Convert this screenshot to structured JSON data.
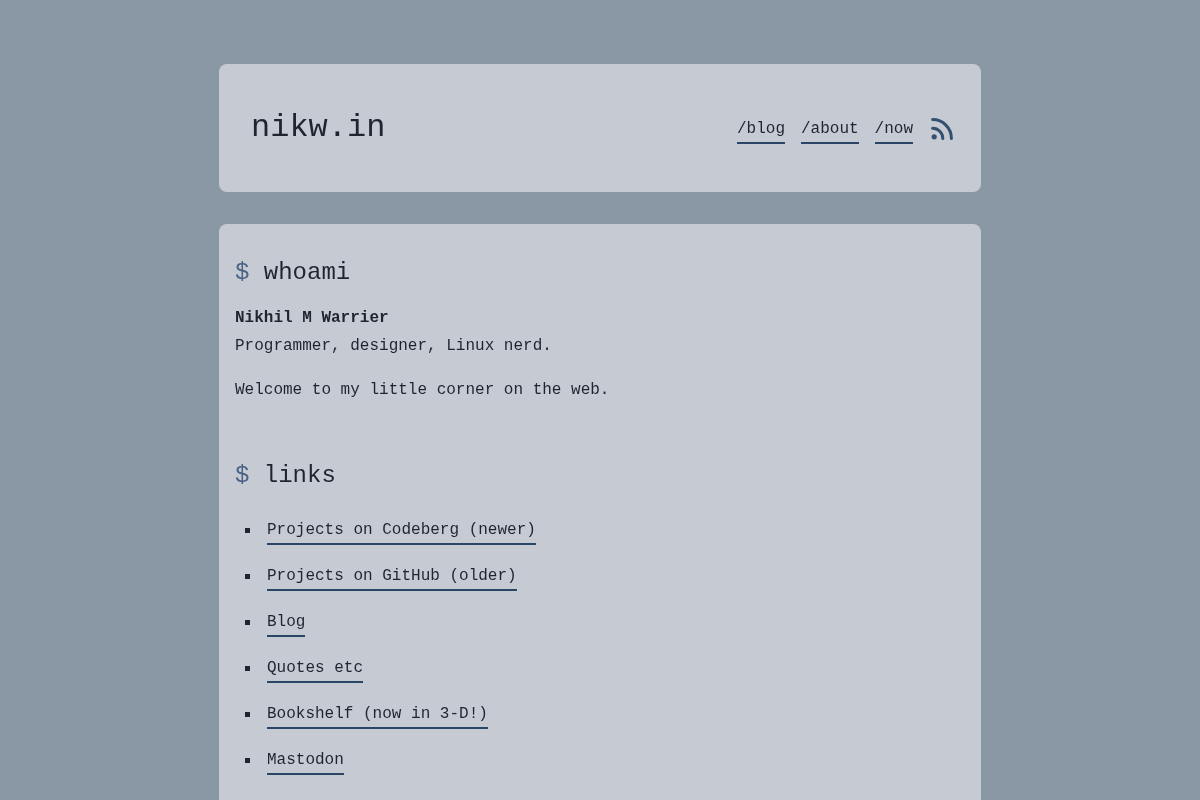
{
  "header": {
    "site_title": "nikw.in",
    "nav": [
      {
        "label": "/blog"
      },
      {
        "label": "/about"
      },
      {
        "label": "/now"
      }
    ]
  },
  "whoami": {
    "prompt": "$",
    "command": "whoami",
    "name": "Nikhil M Warrier",
    "tagline": "Programmer, designer, Linux nerd.",
    "welcome": "Welcome to my little corner on the web."
  },
  "links": {
    "prompt": "$",
    "command": "links",
    "items": [
      {
        "label": "Projects on Codeberg (newer)"
      },
      {
        "label": "Projects on GitHub (older)"
      },
      {
        "label": "Blog"
      },
      {
        "label": "Quotes etc"
      },
      {
        "label": "Bookshelf (now in 3-D!)"
      },
      {
        "label": "Mastodon"
      }
    ]
  }
}
